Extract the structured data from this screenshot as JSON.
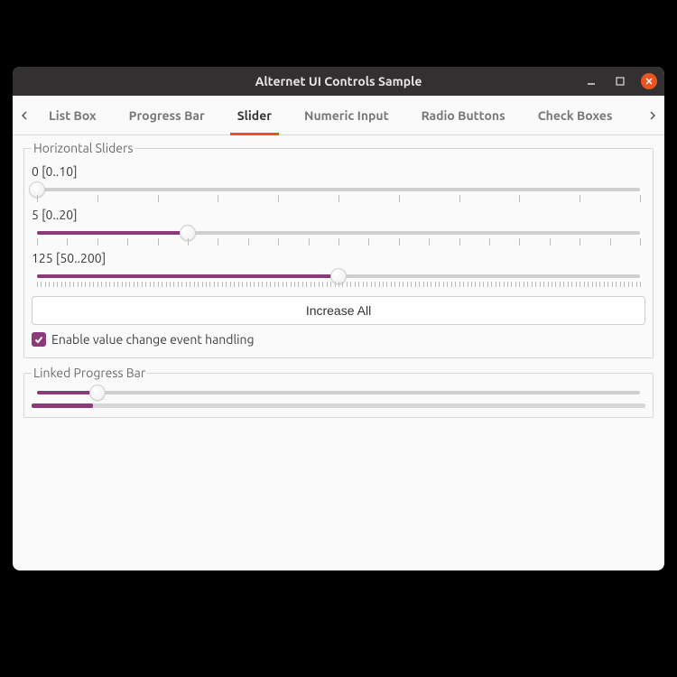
{
  "window": {
    "title": "Alternet UI Controls Sample"
  },
  "tabs": {
    "items": [
      {
        "label": "List Box",
        "active": false
      },
      {
        "label": "Progress Bar",
        "active": false
      },
      {
        "label": "Slider",
        "active": true
      },
      {
        "label": "Numeric Input",
        "active": false
      },
      {
        "label": "Radio Buttons",
        "active": false
      },
      {
        "label": "Check Boxes",
        "active": false
      }
    ]
  },
  "hsliders": {
    "legend": "Horizontal Sliders",
    "sliders": [
      {
        "label": "0 [0..10]",
        "value": 0,
        "min": 0,
        "max": 10,
        "ticks": 11
      },
      {
        "label": "5 [0..20]",
        "value": 5,
        "min": 0,
        "max": 20,
        "ticks": 21
      },
      {
        "label": "125 [50..200]",
        "value": 125,
        "min": 50,
        "max": 200,
        "ticks": 151
      }
    ],
    "increase_button": "Increase All",
    "checkbox_label": "Enable value change event handling",
    "checkbox_checked": true
  },
  "linked": {
    "legend": "Linked Progress Bar",
    "slider": {
      "value": 10,
      "min": 0,
      "max": 100
    },
    "progress": {
      "value": 10,
      "min": 0,
      "max": 100
    }
  },
  "colors": {
    "accent_purple": "#8b3a7a",
    "accent_orange": "#e95420"
  }
}
